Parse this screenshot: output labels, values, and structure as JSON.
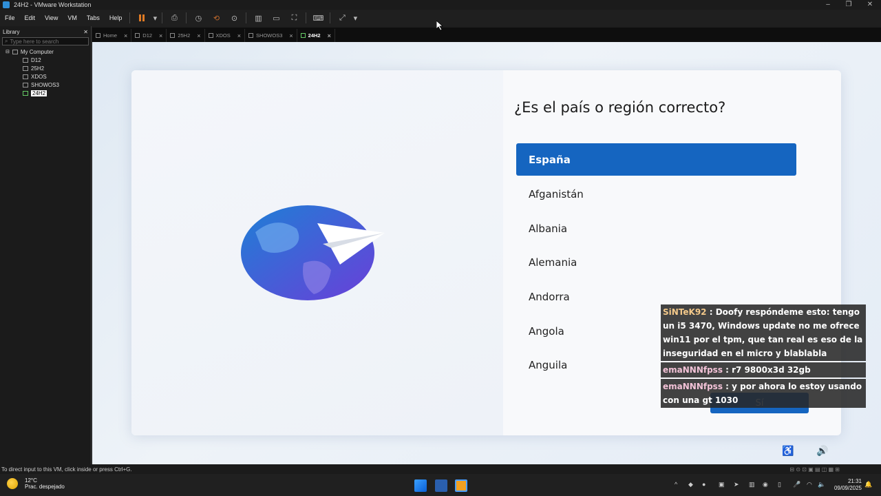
{
  "window": {
    "title": "24H2 - VMware Workstation",
    "minimize": "–",
    "maximize": "❐",
    "close": "✕"
  },
  "menu": [
    "File",
    "Edit",
    "View",
    "VM",
    "Tabs",
    "Help"
  ],
  "library": {
    "title": "Library",
    "close": "✕",
    "search_placeholder": "Type here to search",
    "root": "My Computer",
    "items": [
      "D12",
      "25H2",
      "XDOS",
      "SHOWOS3",
      "24H2"
    ],
    "selected": "24H2"
  },
  "tabs": [
    {
      "label": "Home"
    },
    {
      "label": "D12"
    },
    {
      "label": "25H2"
    },
    {
      "label": "XDOS"
    },
    {
      "label": "SHOWOS3"
    },
    {
      "label": "24H2"
    }
  ],
  "oobe": {
    "question": "¿Es el país o región correcto?",
    "options": [
      "España",
      "Afganistán",
      "Albania",
      "Alemania",
      "Andorra",
      "Angola",
      "Anguila"
    ],
    "selected": "España",
    "yes_button": "Sí"
  },
  "chat": [
    {
      "user": "SiNTeK92",
      "text": ": Doofy respóndeme esto: tengo un i5 3470, Windows update no me ofrece win11 por el tpm, que tan real es eso de la inseguridad en el micro y blablabla"
    },
    {
      "user": "emaNNNfpss",
      "text": ": r7 9800x3d 32gb"
    },
    {
      "user": "emaNNNfpss",
      "text": ": y por ahora lo estoy usando con una gt 1030"
    }
  ],
  "statusbar": {
    "text": "To direct input to this VM, click inside or press Ctrl+G."
  },
  "taskbar": {
    "temp": "12°C",
    "weather": "Prac. despejado",
    "time": "21:31",
    "date": "09/09/2025"
  },
  "colors": {
    "accent": "#1565c0",
    "chat_user1": "#f4c98a",
    "chat_user2": "#f2c2d7"
  }
}
